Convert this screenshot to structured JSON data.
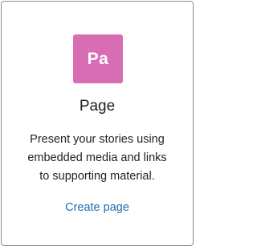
{
  "card": {
    "badge_text": "Pa",
    "badge_color": "#d86db4",
    "title": "Page",
    "description_lines": [
      "Present your stories using",
      "embedded media and links",
      "to supporting material."
    ],
    "link_label": "Create page",
    "link_color": "#1a6fb0",
    "icon": "page-type-badge-icon"
  }
}
